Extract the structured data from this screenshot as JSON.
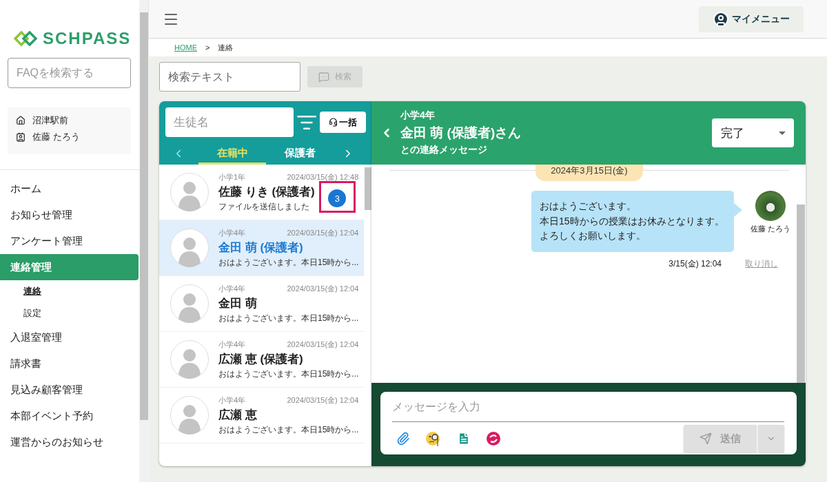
{
  "sidebar": {
    "logo": "SCHPASS",
    "faq_search": {
      "placeholder": "FAQを検索する"
    },
    "account": {
      "school": "沼津駅前",
      "user": "佐藤 たろう"
    },
    "items": [
      {
        "label": "ホーム",
        "selected": false
      },
      {
        "label": "お知らせ管理",
        "selected": false
      },
      {
        "label": "アンケート管理",
        "selected": false
      },
      {
        "label": "連絡管理",
        "selected": true,
        "children": [
          {
            "label": "連絡",
            "selected": true
          },
          {
            "label": "設定",
            "selected": false
          }
        ]
      },
      {
        "label": "入退室管理",
        "selected": false
      },
      {
        "label": "請求書",
        "selected": false
      },
      {
        "label": "見込み顧客管理",
        "selected": false
      },
      {
        "label": "本部イベント予約",
        "selected": false
      },
      {
        "label": "運営からのお知らせ",
        "selected": false
      }
    ]
  },
  "topbar": {
    "my_menu": "マイメニュー"
  },
  "breadcrumb": [
    {
      "label": "HOME",
      "kind": "link"
    },
    {
      "label": ">",
      "kind": "separator"
    },
    {
      "label": "連絡",
      "kind": "current"
    }
  ],
  "search": {
    "placeholder": "検索テキスト",
    "button": "検索",
    "disabled": true
  },
  "contact_list": {
    "search": {
      "placeholder": "生徒名"
    },
    "bulk_button": "一括",
    "tabs": [
      {
        "label": "在籍中",
        "selected": true
      },
      {
        "label": "保護者",
        "selected": false
      }
    ],
    "contacts": [
      {
        "grade": "小学1年",
        "date": "2024/03/15(金) 12:48",
        "name": "佐藤 りき (保護者)",
        "preview": "ファイルを送信しました",
        "unread": "3",
        "highlighted": true,
        "selected": false
      },
      {
        "grade": "小学4年",
        "date": "2024/03/15(金) 12:04",
        "name": "金田 萌 (保護者)",
        "preview": "おはようございます。本日15時から...",
        "selected": true
      },
      {
        "grade": "小学4年",
        "date": "2024/03/15(金) 12:04",
        "name": "金田 萌",
        "preview": "おはようございます。本日15時から...",
        "selected": false
      },
      {
        "grade": "小学4年",
        "date": "2024/03/15(金) 12:04",
        "name": "広瀬 恵 (保護者)",
        "preview": "おはようございます。本日15時から...",
        "selected": false
      },
      {
        "grade": "小学4年",
        "date": "2024/03/15(金) 12:04",
        "name": "広瀬 恵",
        "preview": "おはようございます。本日15時から...",
        "selected": false
      }
    ]
  },
  "chat": {
    "grade": "小学4年",
    "name": "金田 萌 (保護者)さん",
    "subtitle": "との連絡メッセージ",
    "status": "完了",
    "date_chip": "2024年3月15日(金)",
    "messages": [
      {
        "lines": [
          "おはようございます。",
          "本日15時からの授業はお休みとなります。",
          "よろしくお願いします。"
        ],
        "sender": "佐藤 たろう",
        "time": "3/15(金) 12:04",
        "action": "取り消し"
      }
    ],
    "composer": {
      "placeholder": "メッセージを入力",
      "send": "送信",
      "send_disabled": true
    }
  }
}
